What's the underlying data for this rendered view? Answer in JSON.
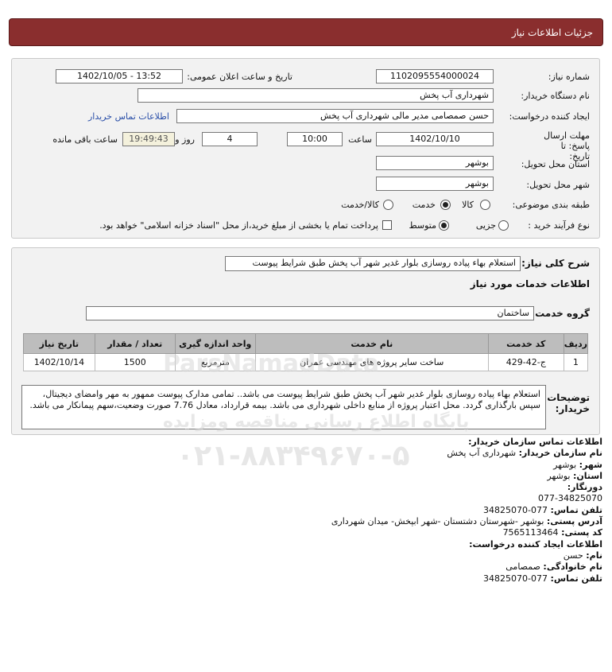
{
  "page_title": "جزئيات اطلاعات نياز",
  "need": {
    "number_label": "شماره نیاز:",
    "number": "1102095554000024",
    "announce_label": "تاریخ و ساعت اعلان عمومی:",
    "announce_value": "1402/10/05 - 13:52",
    "buyer_org_label": "نام دستگاه خریدار:",
    "buyer_org": "شهرداری آب پخش",
    "creator_label": "ایجاد کننده درخواست:",
    "creator": "حسن صمصامی مدیر مالی شهرداری آب پخش",
    "contact_link": "اطلاعات تماس خریدار",
    "deadline_label": "مهلت ارسال پاسخ: تا تاریخ:",
    "deadline_date": "1402/10/10",
    "time_label": "ساعت",
    "deadline_time": "10:00",
    "days": "4",
    "days_label": "روز و",
    "remaining": "19:49:43",
    "remaining_label": "ساعت باقی مانده",
    "province_label": "استان محل تحویل:",
    "province": "بوشهر",
    "city_label": "شهر محل تحویل:",
    "city": "بوشهر",
    "category_label": "طبقه بندی موضوعی:",
    "category_options": [
      "کالا",
      "خدمت",
      "کالا/خدمت"
    ],
    "category_selected": "خدمت",
    "process_label": "نوع فرآیند خرید :",
    "process_options": [
      "جزیی",
      "متوسط"
    ],
    "process_selected": "متوسط",
    "payment_note": "پرداخت تمام یا بخشی از مبلغ خرید،از محل \"اسناد خزانه اسلامی\" خواهد بود."
  },
  "summary": {
    "label": "شرح کلی نیاز:",
    "value": "استعلام بهاء پیاده روسازی بلوار غدیر شهر آب پخش طبق شرایط پیوست",
    "services_heading": "اطلاعات خدمات مورد نیاز",
    "service_group_label": "گروه خدمت:",
    "service_group": "ساختمان",
    "table_headers": [
      "ردیف",
      "کد خدمت",
      "نام خدمت",
      "واحد اندازه گیری",
      "تعداد / مقدار",
      "تاریخ نیاز"
    ],
    "rows": [
      {
        "row": "1",
        "code": "ج-42-429",
        "name": "ساخت سایر پروژه های مهندسی عمران",
        "unit": "مترمربع",
        "qty": "1500",
        "date": "1402/10/14"
      }
    ],
    "notes_label": "توضیحات خریدار:",
    "notes": "استعلام بهاء پیاده روسازی بلوار غدیر شهر آب پخش طبق شرایط پیوست می باشد.. تمامی مدارک پیوست ممهور به مهر وامضای دیجیتال، سپس بارگذاری گردد. محل اعتبار پروژه از منابع داخلی شهرداری می باشد. بیمه قرارداد، معادل 7.76 صورت وضعیت،سهم پیمانکار می باشد."
  },
  "contact": {
    "buyer_heading": "اطلاعات تماس سازمان خریدار:",
    "org_label": "نام سازمان خریدار:",
    "org": "شهرداری آب پخش",
    "city_label": "شهر:",
    "city": "بوشهر",
    "province_label": "استان:",
    "province": "بوشهر",
    "fax_label": "دورنگار:",
    "fax": "077-34825070",
    "phone_label": "تلفن تماس:",
    "phone": "077-34825070",
    "address_label": "آدرس پستی:",
    "address": "بوشهر -شهرستان دشتستان -شهر ابپخش- میدان شهرداری",
    "postal_label": "کد پستی:",
    "postal": "7565113464",
    "creator_heading": "اطلاعات ایجاد کننده درخواست:",
    "first_name_label": "نام:",
    "first_name": "حسن",
    "last_name_label": "نام خانوادگی:",
    "last_name": "صمصامی",
    "creator_phone_label": "تلفن تماس:",
    "creator_phone": "077-34825070"
  },
  "watermark": {
    "brand": "ParsNamadData",
    "site_text": "پایگاه اطلاع رسانی مناقصه ومزایده",
    "phone": "۰۲۱-۸۸۳۴۹۶۷۰-۵"
  },
  "colors": {
    "title_bg": "#8a2e2e",
    "panel_bg": "#f2f2f2",
    "table_header_bg": "#bdbdbd",
    "link": "#2a4fa8"
  }
}
